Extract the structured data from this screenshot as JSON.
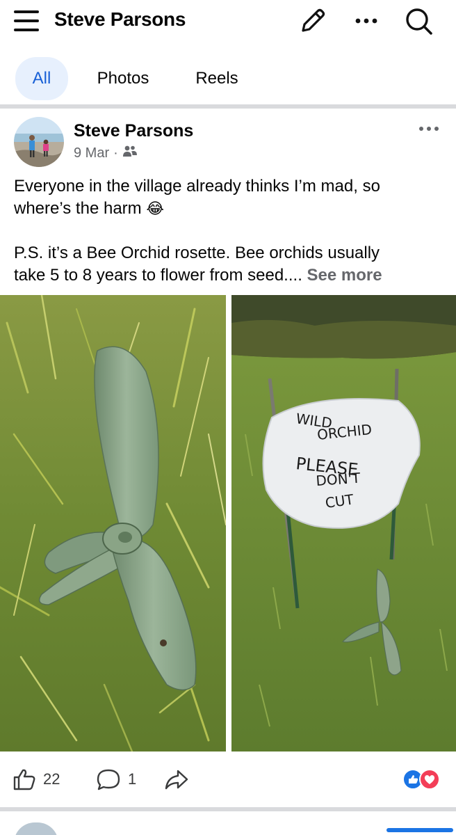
{
  "header": {
    "title": "Steve Parsons",
    "icons": [
      "menu-icon",
      "edit-icon",
      "more-icon",
      "search-icon"
    ]
  },
  "tabs": [
    {
      "label": "All",
      "active": true
    },
    {
      "label": "Photos",
      "active": false
    },
    {
      "label": "Reels",
      "active": false
    }
  ],
  "post": {
    "author": "Steve Parsons",
    "date": "9 Mar",
    "separator": "·",
    "audience_icon": "friends-icon",
    "text_line1": "Everyone in the village already thinks I’m mad, so",
    "text_line2": "where’s the harm",
    "emoji": "😂",
    "text_line3": "P.S. it’s a Bee Orchid rosette. Bee orchids usually",
    "text_line4": "take 5 to 8 years to flower from seed....",
    "see_more": "See more",
    "sign_text": [
      "WILD",
      "ORCHID",
      "PLEASE",
      "DON'T",
      "CUT"
    ]
  },
  "actions": {
    "like_count": "22",
    "comment_count": "1",
    "reaction_icons": [
      "like-reaction-icon",
      "love-reaction-icon"
    ]
  },
  "colors": {
    "accent": "#1860d6",
    "tab_active_bg": "#e7f0fd",
    "meta_gray": "#65676b",
    "like_blue": "#1b74e4",
    "love_red": "#f33e58"
  }
}
